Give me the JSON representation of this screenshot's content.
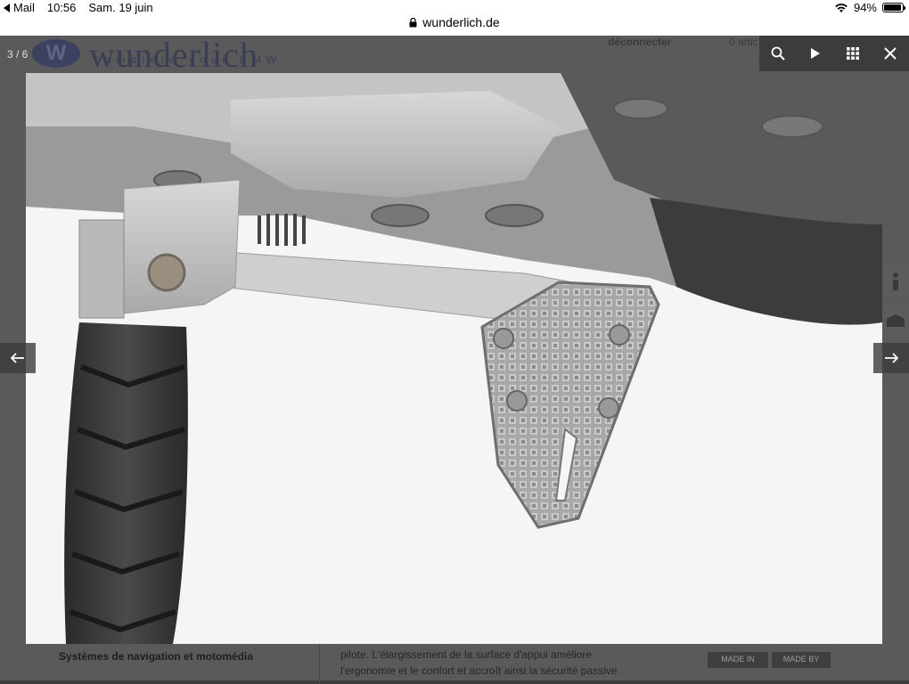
{
  "status_bar": {
    "back_app": "Mail",
    "time": "10:56",
    "date": "Sam. 19 juin",
    "battery": "94%",
    "battery_level": 0.94,
    "url": "wunderlich.de"
  },
  "background_page": {
    "logo_brand": "wunderlich",
    "logo_badge": "W",
    "tagline": "complete your BMW.",
    "account_link": "déconnecter",
    "cart_count": "0 artic",
    "nav_item": "Systèmes de navigation et motomédia",
    "description_line1": "pilote. L'élargissement de la surface d'appui améliore",
    "description_line2": "l'ergonomie et le confort et accroît ainsi la sécurité passive",
    "badge_made_in": "MADE IN",
    "badge_made_by": "MADE BY"
  },
  "lightbox": {
    "counter": "3 / 6",
    "tools": [
      "search-icon",
      "play-icon",
      "grid-icon",
      "close-icon"
    ],
    "prev_icon": "arrow-left-icon",
    "next_icon": "arrow-right-icon",
    "image_subject": "side-stand-foot-enlarger"
  },
  "colors": {
    "overlay": "#3d3d3d",
    "toolbar_icon": "#ffffff",
    "photo_bg": "#f4f4f4"
  }
}
